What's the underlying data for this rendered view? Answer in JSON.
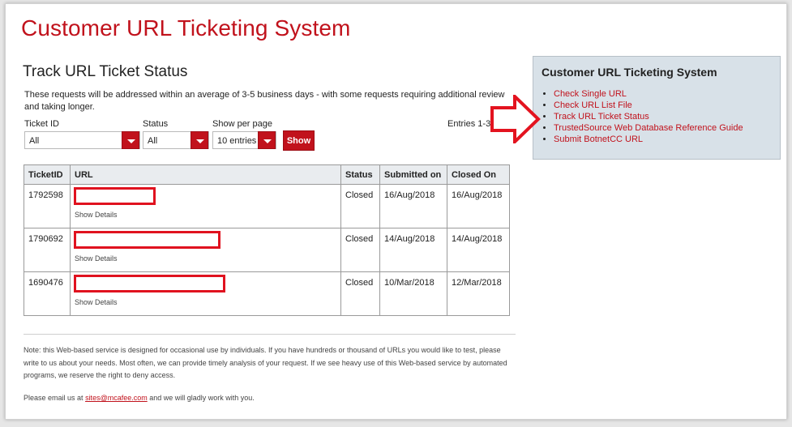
{
  "app_title": "Customer URL Ticketing System",
  "section_title": "Track URL Ticket Status",
  "intro": "These requests will be addressed within an average of 3-5 business days - with some requests requiring additional review and taking longer.",
  "filters": {
    "ticket_id": {
      "label": "Ticket ID",
      "value": "All"
    },
    "status": {
      "label": "Status",
      "value": "All"
    },
    "per_page": {
      "label": "Show per page",
      "value": "10 entries"
    },
    "show_button": "Show",
    "entries_text": "Entries 1-3"
  },
  "table": {
    "headers": [
      "TicketID",
      "URL",
      "Status",
      "Submitted on",
      "Closed On"
    ],
    "show_details_label": "Show Details",
    "rows": [
      {
        "ticket_id": "1792598",
        "status": "Closed",
        "submitted": "16/Aug/2018",
        "closed": "16/Aug/2018"
      },
      {
        "ticket_id": "1790692",
        "status": "Closed",
        "submitted": "14/Aug/2018",
        "closed": "14/Aug/2018"
      },
      {
        "ticket_id": "1690476",
        "status": "Closed",
        "submitted": "10/Mar/2018",
        "closed": "12/Mar/2018"
      }
    ]
  },
  "footer": {
    "note": "Note: this Web-based service is designed for occasional use by individuals. If you have hundreds or thousand of URLs you would like to test, please write to us about your needs. Most often, we can provide timely analysis of your request. If we see heavy use of this Web-based service by automated programs, we reserve the right to deny access.",
    "email_prefix": "Please email us at",
    "email": "sites@mcafee.com",
    "email_suffix": "and we will gladly work with you."
  },
  "sidebar": {
    "title": "Customer URL Ticketing System",
    "links": [
      "Check Single URL",
      "Check URL List File",
      "Track URL Ticket Status",
      "TrustedSource Web Database Reference Guide",
      "Submit BotnetCC URL"
    ]
  },
  "colors": {
    "brand_red": "#c1121c",
    "sidebar_bg": "#d8e1e8",
    "redaction_red": "#e0121f",
    "arrow_red": "#e3131f"
  }
}
